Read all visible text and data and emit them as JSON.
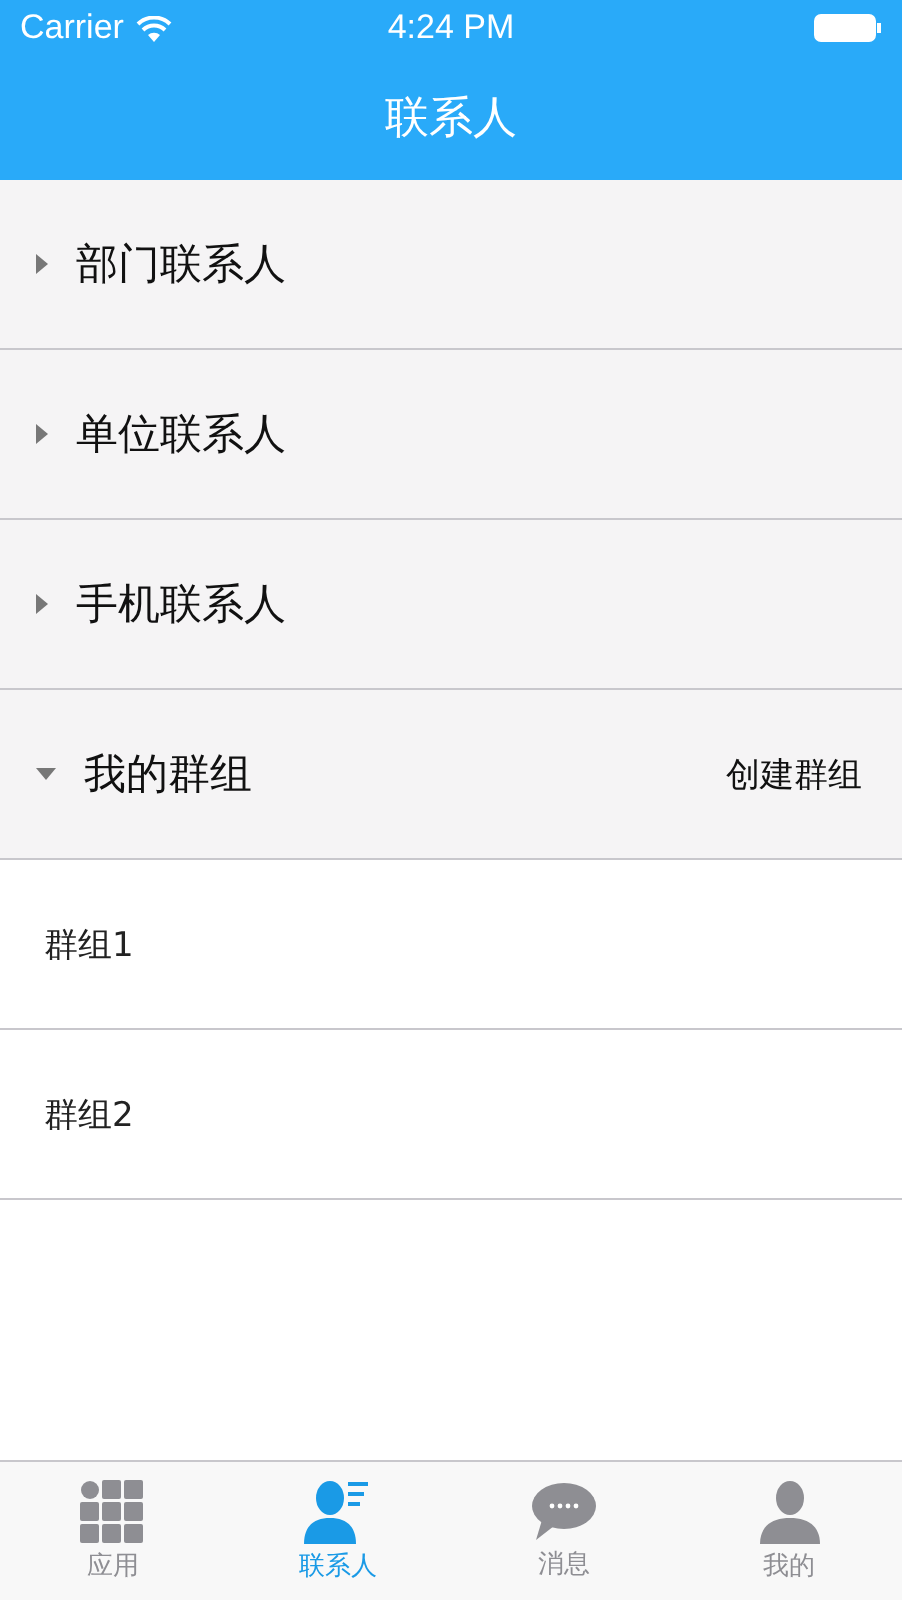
{
  "status_bar": {
    "carrier": "Carrier",
    "time": "4:24 PM"
  },
  "nav_bar": {
    "title": "联系人"
  },
  "sections": [
    {
      "label": "部门联系人",
      "expanded": false
    },
    {
      "label": "单位联系人",
      "expanded": false
    },
    {
      "label": "手机联系人",
      "expanded": false
    },
    {
      "label": "我的群组",
      "expanded": true,
      "action": "创建群组",
      "children": [
        {
          "label": "群组1"
        },
        {
          "label": "群组2"
        }
      ]
    }
  ],
  "tab_bar": [
    {
      "label": "应用",
      "kind": "apps",
      "selected": false
    },
    {
      "label": "联系人",
      "kind": "contacts",
      "selected": true
    },
    {
      "label": "消息",
      "kind": "messages",
      "selected": false
    },
    {
      "label": "我的",
      "kind": "profile",
      "selected": false
    }
  ]
}
